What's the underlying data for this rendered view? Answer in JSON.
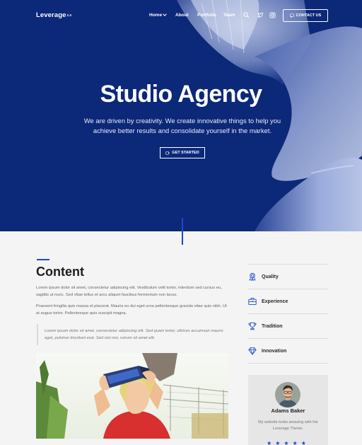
{
  "brand": {
    "name": "Leverage",
    "version": "2.0"
  },
  "nav": {
    "items": [
      "Home",
      "About",
      "Portfolio",
      "Team"
    ],
    "icons": [
      "search-icon",
      "twitter-icon",
      "instagram-icon"
    ],
    "contact_label": "CONTACT US"
  },
  "hero": {
    "title": "Studio Agency",
    "subtitle": "We are driven by creativity. We create innovative things to help you achieve better results and consolidate yourself in the market.",
    "cta_label": "GET STARTED"
  },
  "content": {
    "title": "Content",
    "paragraph1": "Lorem ipsum dolor sit amet, consectetur adipiscing elit. Vestibulum velit tortor, interdum sed cursus eu, sagittis ut nunc. Sed vitae tellus et arcu aliquet faucibus fermentum non lacus.",
    "paragraph2": "Praesent fringilla quis massa et placerat. Mauris eu dui eget urna pellentesque gravida vitae quis nibh. Ut at augue tortor. Pellentesque quis suscipit magna.",
    "quote": "Lorem ipsum dolor sit amet, consectetur adipiscing elit. Sed quam tortor, ultrices accumsan mauris eget, pulvinar tincidunt erat. Sed nisi nisi, rutrum sit amet elit."
  },
  "sidebar": {
    "items": [
      {
        "label": "Quality",
        "icon": "award-icon"
      },
      {
        "label": "Experience",
        "icon": "briefcase-icon"
      },
      {
        "label": "Tradition",
        "icon": "trophy-icon"
      },
      {
        "label": "Innovation",
        "icon": "diamond-icon"
      }
    ]
  },
  "testimonial": {
    "name": "Adams Baker",
    "text": "My website looks amazing with the Leverage Theme.",
    "rating": 5,
    "stars": "★★★★★"
  },
  "colors": {
    "hero_bg": "#0c2878",
    "accent": "#1c49c9",
    "page_bg": "#f4f4f4"
  }
}
